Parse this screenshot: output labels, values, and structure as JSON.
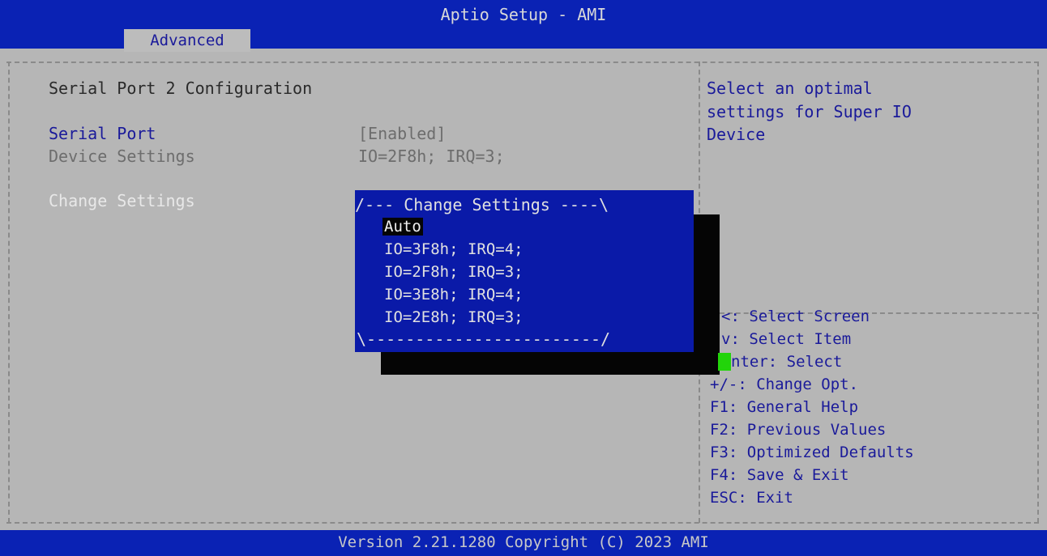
{
  "header": {
    "title": "Aptio Setup - AMI",
    "active_tab": "Advanced"
  },
  "main": {
    "section_title": "Serial Port 2 Configuration",
    "settings": [
      {
        "label": "Serial Port",
        "value": "[Enabled]"
      },
      {
        "label": "Device Settings",
        "value": "IO=2F8h; IRQ=3;"
      },
      {
        "label": "Change Settings",
        "value": ""
      }
    ]
  },
  "popup": {
    "title": "/--- Change Settings ----\\",
    "options": [
      "Auto",
      "IO=3F8h; IRQ=4;",
      "IO=2F8h; IRQ=3;",
      "IO=3E8h; IRQ=4;",
      "IO=2E8h; IRQ=3;"
    ],
    "selected_index": 0,
    "bottom_border": "\\------------------------/"
  },
  "help": {
    "description": [
      "Select an optimal",
      "settings for Super IO",
      "Device"
    ],
    "keys": [
      "<: Select Screen",
      "v: Select Item",
      "nter: Select",
      "+/-: Change Opt.",
      "F1: General Help",
      "F2: Previous Values",
      "F3: Optimized Defaults",
      "F4: Save & Exit",
      "ESC: Exit"
    ]
  },
  "footer": {
    "version": "Version 2.21.1280 Copyright (C) 2023 AMI"
  },
  "colors": {
    "title_bar": "#0a22b4",
    "panel_bg": "#b6b6b6",
    "popup_bg": "#0a1aa8",
    "cursor_green": "#22d40a"
  }
}
